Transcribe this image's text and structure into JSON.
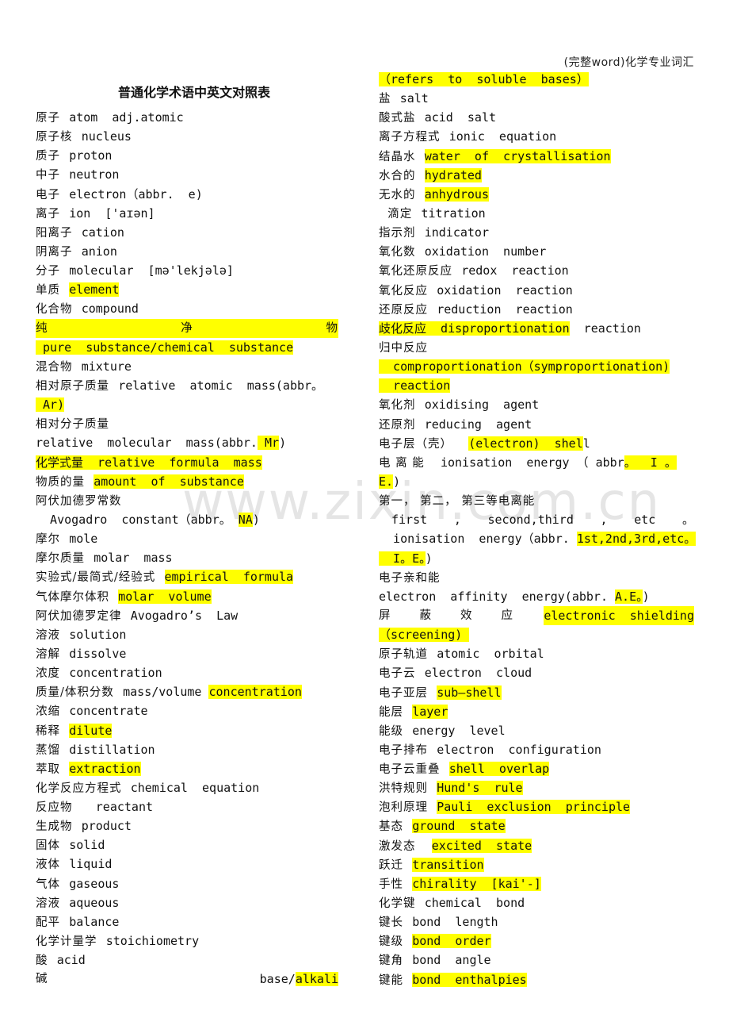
{
  "header": {
    "doc_label": "(完整word)化学专业词汇"
  },
  "title": "普通化学术语中英文对照表",
  "watermark": "www.zixin.com.cn",
  "colors": {
    "highlight": "#ffff00",
    "text": "#111111"
  },
  "left_column": [
    {
      "cn": "原子",
      "en": "atom  adj.atomic",
      "hl": ""
    },
    {
      "cn": "原子核",
      "en": "nucleus",
      "hl": ""
    },
    {
      "cn": "质子",
      "en": "proton",
      "hl": ""
    },
    {
      "cn": "中子",
      "en": "neutron",
      "hl": ""
    },
    {
      "cn": "电子",
      "en": "electron（abbr.  e)",
      "hl": ""
    },
    {
      "cn": "离子",
      "en": "ion  ['aɪən]",
      "hl": ""
    },
    {
      "cn": "阳离子",
      "en": "cation",
      "hl": ""
    },
    {
      "cn": "阴离子",
      "en": "anion",
      "hl": ""
    },
    {
      "cn": "分子",
      "en": "molecular  [mə'lekjələ]",
      "hl": ""
    },
    {
      "cn": "单质",
      "en": "",
      "hl": "element"
    },
    {
      "cn": "化合物",
      "en": "compound",
      "hl": ""
    },
    {
      "justify": [
        "纯",
        "净",
        "物"
      ],
      "hl_line": true
    },
    {
      "cn": "",
      "en": "",
      "hl": " pure  substance/chemical  substance",
      "indent": true
    },
    {
      "cn": "混合物",
      "en": "mixture",
      "hl": ""
    },
    {
      "cn": "相对原子质量",
      "en": "relative  atomic  mass(abbr。",
      "hl": ""
    },
    {
      "cn": "",
      "en": "",
      "hl": " Ar)",
      "indent": true
    },
    {
      "cn": "相对分子质量",
      "en": "",
      "hl": ""
    },
    {
      "cn": "",
      "en": "relative  molecular  mass(abbr.",
      "hl": " Mr",
      "tail": ")"
    },
    {
      "cn": "",
      "en": "",
      "hl": "化学式量  relative  formula  mass"
    },
    {
      "cn": "物质的量",
      "en": "",
      "hl": "amount  of  substance"
    },
    {
      "cn": "阿伏加德罗常数",
      "en": "",
      "hl": ""
    },
    {
      "cn": "",
      "en": "  Avogadro  constant（abbr。 ",
      "hl": "NA",
      "tail": ")"
    },
    {
      "cn": "摩尔",
      "en": "mole",
      "hl": ""
    },
    {
      "cn": "摩尔质量",
      "en": "molar  mass",
      "hl": ""
    },
    {
      "cn": "实验式/最简式/经验式",
      "en": "",
      "hl": "empirical  formula"
    },
    {
      "cn": "气体摩尔体积",
      "en": "",
      "hl": "molar  volume"
    },
    {
      "cn": "阿伏加德罗定律",
      "en": "Avogadro’s  Law",
      "hl": ""
    },
    {
      "cn": "溶液",
      "en": "solution",
      "hl": ""
    },
    {
      "cn": "溶解",
      "en": "dissolve",
      "hl": ""
    },
    {
      "cn": "浓度",
      "en": "concentration",
      "hl": ""
    },
    {
      "cn": "质量/体积分数",
      "en": "mass/volume ",
      "hl": "concentration"
    },
    {
      "cn": "浓缩",
      "en": "concentrate",
      "hl": ""
    },
    {
      "cn": "稀释",
      "en": "",
      "hl": "dilute"
    },
    {
      "cn": "蒸馏",
      "en": "distillation",
      "hl": ""
    },
    {
      "cn": "萃取",
      "en": "",
      "hl": "extraction"
    },
    {
      "cn": "化学反应方程式",
      "en": "chemical  equation",
      "hl": ""
    },
    {
      "cn": "反应物",
      "en": "  reactant",
      "hl": ""
    },
    {
      "cn": "生成物",
      "en": "product",
      "hl": ""
    },
    {
      "cn": "固体",
      "en": "solid",
      "hl": ""
    },
    {
      "cn": "液体",
      "en": "liquid",
      "hl": ""
    },
    {
      "cn": "气体",
      "en": "gaseous",
      "hl": ""
    },
    {
      "cn": "溶液",
      "en": "aqueous",
      "hl": ""
    },
    {
      "cn": "配平",
      "en": "balance",
      "hl": ""
    },
    {
      "cn": "化学计量学",
      "en": "stoichiometry",
      "hl": ""
    },
    {
      "cn": "酸",
      "en": "acid",
      "hl": ""
    },
    {
      "justify_pair": true,
      "cn": "碱",
      "en": "base/",
      "hl": "alkali"
    }
  ],
  "right_column": [
    {
      "cn": "",
      "en": "",
      "hl": "（refers  to  soluble  bases）"
    },
    {
      "cn": "盐",
      "en": "salt",
      "hl": ""
    },
    {
      "cn": "酸式盐",
      "en": "acid  salt",
      "hl": ""
    },
    {
      "cn": "离子方程式",
      "en": "ionic  equation",
      "hl": ""
    },
    {
      "cn": "结晶水",
      "en": "",
      "hl": "water  of  crystallisation"
    },
    {
      "cn": "水合的",
      "en": "",
      "hl": "hydrated"
    },
    {
      "cn": "无水的",
      "en": "",
      "hl": "anhydrous"
    },
    {
      "cn": "  滴定",
      "en": "titration",
      "hl": ""
    },
    {
      "cn": "指示剂",
      "en": "indicator",
      "hl": ""
    },
    {
      "cn": "氧化数",
      "en": "oxidation  number",
      "hl": ""
    },
    {
      "cn": "氧化还原反应",
      "en": "redox  reaction",
      "hl": ""
    },
    {
      "cn": "氧化反应",
      "en": "oxidation  reaction",
      "hl": ""
    },
    {
      "cn": "还原反应",
      "en": "reduction  reaction",
      "hl": ""
    },
    {
      "cn": "",
      "en": "",
      "hl": "歧化反应  disproportionation",
      "tail": "  reaction"
    },
    {
      "cn": "归中反应",
      "en": "",
      "hl": ""
    },
    {
      "cn": "",
      "en": "",
      "hl": "  comproportionation（symproportionation)"
    },
    {
      "cn": "",
      "en": "",
      "hl": "  reaction"
    },
    {
      "cn": "氧化剂",
      "en": "oxidising  agent",
      "hl": ""
    },
    {
      "cn": "还原剂",
      "en": "reducing  agent",
      "hl": ""
    },
    {
      "cn": "电子层（壳）",
      "en": " ",
      "hl": "(electron)  shel",
      "tail": "l"
    },
    {
      "cn": "电 离 能",
      "en": " ionisation  energy （ abbr",
      "hl": "。  I 。"
    },
    {
      "cn": "",
      "en": "",
      "hl": "E.",
      "tail": ")"
    },
    {
      "cn": "第一， 第二， 第三等电离能",
      "en": "",
      "hl": ""
    },
    {
      "justify_words": [
        "first",
        ",",
        "second,third",
        ",",
        "etc",
        "。"
      ]
    },
    {
      "cn": "",
      "en": "  ionisation  energy（abbr. ",
      "hl": "1st,2nd,3rd,etc。"
    },
    {
      "cn": "",
      "en": "",
      "hl": "  I。E。",
      "tail": ")"
    },
    {
      "cn": "电子亲和能",
      "en": "",
      "hl": ""
    },
    {
      "cn": "",
      "en": "electron  affinity  energy(abbr. ",
      "hl": "A.E。",
      "tail": ")"
    },
    {
      "justify_hl": [
        "屏",
        "蔽",
        "效",
        "应"
      ],
      "hl": "electronic  shielding"
    },
    {
      "cn": "",
      "en": "",
      "hl": "（screening) "
    },
    {
      "cn": "原子轨道",
      "en": "atomic  orbital",
      "hl": ""
    },
    {
      "cn": "电子云",
      "en": "electron  cloud",
      "hl": ""
    },
    {
      "cn": "电子亚层",
      "en": "",
      "hl": "sub—shell"
    },
    {
      "cn": "能层",
      "en": "",
      "hl": "layer"
    },
    {
      "cn": "能级",
      "en": "energy  level",
      "hl": ""
    },
    {
      "cn": "电子排布",
      "en": "electron  configuration",
      "hl": ""
    },
    {
      "cn": "电子云重叠",
      "en": "",
      "hl": "shell  overlap"
    },
    {
      "cn": "洪特规则",
      "en": "",
      "hl": "Hund's  rule"
    },
    {
      "cn": "泡利原理",
      "en": "",
      "hl": "Pauli  exclusion  principle"
    },
    {
      "cn": "基态",
      "en": "",
      "hl": "ground  state"
    },
    {
      "cn": "激发态",
      "en": " ",
      "hl": "excited  state"
    },
    {
      "cn": "跃迁",
      "en": "",
      "hl": "transition"
    },
    {
      "cn": "手性",
      "en": "",
      "hl": "chirality  [kai'-]"
    },
    {
      "cn": "化学键",
      "en": "chemical  bond",
      "hl": ""
    },
    {
      "cn": "键长",
      "en": "bond  length",
      "hl": ""
    },
    {
      "cn": "键级",
      "en": "",
      "hl": "bond  order"
    },
    {
      "cn": "键角",
      "en": "bond  angle",
      "hl": ""
    },
    {
      "cn": "键能",
      "en": "",
      "hl": "bond  enthalpies"
    }
  ]
}
